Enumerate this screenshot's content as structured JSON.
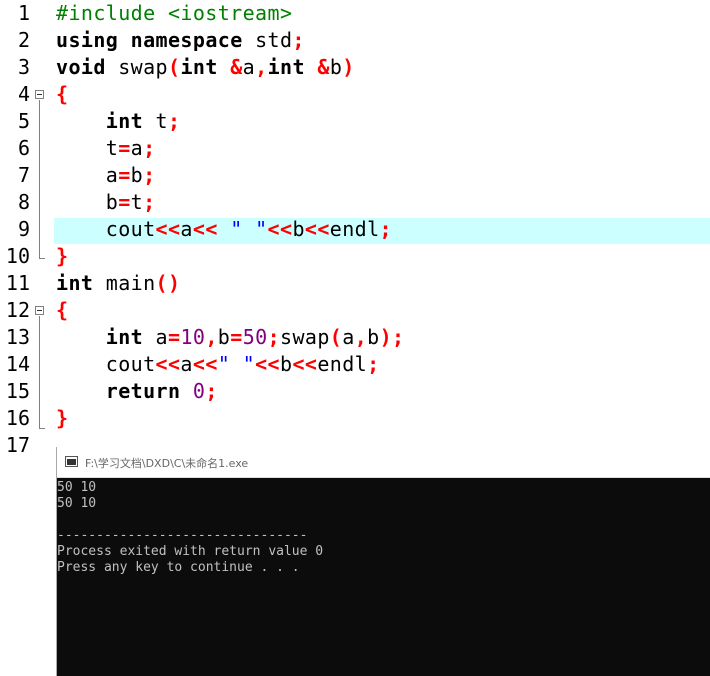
{
  "editor": {
    "active_line": 9,
    "lines": [
      {
        "n": "1",
        "tokens": [
          {
            "t": "#include <iostream>",
            "c": "pp"
          }
        ]
      },
      {
        "n": "2",
        "tokens": [
          {
            "t": "using",
            "c": "kw"
          },
          {
            "t": " ",
            "c": ""
          },
          {
            "t": "namespace",
            "c": "kw"
          },
          {
            "t": " std",
            "c": ""
          },
          {
            "t": ";",
            "c": "sym"
          }
        ]
      },
      {
        "n": "3",
        "tokens": [
          {
            "t": "void",
            "c": "kw"
          },
          {
            "t": " swap",
            "c": ""
          },
          {
            "t": "(",
            "c": "sym"
          },
          {
            "t": "int",
            "c": "kw"
          },
          {
            "t": " ",
            "c": ""
          },
          {
            "t": "&",
            "c": "sym"
          },
          {
            "t": "a",
            "c": ""
          },
          {
            "t": ",",
            "c": "sym"
          },
          {
            "t": "int",
            "c": "kw"
          },
          {
            "t": " ",
            "c": ""
          },
          {
            "t": "&",
            "c": "sym"
          },
          {
            "t": "b",
            "c": ""
          },
          {
            "t": ")",
            "c": "sym"
          }
        ]
      },
      {
        "n": "4",
        "tokens": [
          {
            "t": "{",
            "c": "sym"
          }
        ]
      },
      {
        "n": "5",
        "tokens": [
          {
            "t": "    ",
            "c": ""
          },
          {
            "t": "int",
            "c": "kw"
          },
          {
            "t": " t",
            "c": ""
          },
          {
            "t": ";",
            "c": "sym"
          }
        ]
      },
      {
        "n": "6",
        "tokens": [
          {
            "t": "    t",
            "c": ""
          },
          {
            "t": "=",
            "c": "sym"
          },
          {
            "t": "a",
            "c": ""
          },
          {
            "t": ";",
            "c": "sym"
          }
        ]
      },
      {
        "n": "7",
        "tokens": [
          {
            "t": "    a",
            "c": ""
          },
          {
            "t": "=",
            "c": "sym"
          },
          {
            "t": "b",
            "c": ""
          },
          {
            "t": ";",
            "c": "sym"
          }
        ]
      },
      {
        "n": "8",
        "tokens": [
          {
            "t": "    b",
            "c": ""
          },
          {
            "t": "=",
            "c": "sym"
          },
          {
            "t": "t",
            "c": ""
          },
          {
            "t": ";",
            "c": "sym"
          }
        ]
      },
      {
        "n": "9",
        "tokens": [
          {
            "t": "    cout",
            "c": ""
          },
          {
            "t": "<<",
            "c": "sym"
          },
          {
            "t": "a",
            "c": ""
          },
          {
            "t": "<<",
            "c": "sym"
          },
          {
            "t": " ",
            "c": ""
          },
          {
            "t": "\" \"",
            "c": "str"
          },
          {
            "t": "<<",
            "c": "sym"
          },
          {
            "t": "b",
            "c": ""
          },
          {
            "t": "<<",
            "c": "sym"
          },
          {
            "t": "endl",
            "c": ""
          },
          {
            "t": ";",
            "c": "sym"
          }
        ]
      },
      {
        "n": "10",
        "tokens": [
          {
            "t": "}",
            "c": "sym"
          }
        ]
      },
      {
        "n": "11",
        "tokens": [
          {
            "t": "int",
            "c": "kw"
          },
          {
            "t": " main",
            "c": ""
          },
          {
            "t": "()",
            "c": "sym"
          }
        ]
      },
      {
        "n": "12",
        "tokens": [
          {
            "t": "{",
            "c": "sym"
          }
        ]
      },
      {
        "n": "13",
        "tokens": [
          {
            "t": "    ",
            "c": ""
          },
          {
            "t": "int",
            "c": "kw"
          },
          {
            "t": " a",
            "c": ""
          },
          {
            "t": "=",
            "c": "sym"
          },
          {
            "t": "10",
            "c": "num-lit"
          },
          {
            "t": ",",
            "c": "sym"
          },
          {
            "t": "b",
            "c": ""
          },
          {
            "t": "=",
            "c": "sym"
          },
          {
            "t": "50",
            "c": "num-lit"
          },
          {
            "t": ";",
            "c": "sym"
          },
          {
            "t": "swap",
            "c": ""
          },
          {
            "t": "(",
            "c": "sym"
          },
          {
            "t": "a",
            "c": ""
          },
          {
            "t": ",",
            "c": "sym"
          },
          {
            "t": "b",
            "c": ""
          },
          {
            "t": ");",
            "c": "sym"
          }
        ]
      },
      {
        "n": "14",
        "tokens": [
          {
            "t": "    cout",
            "c": ""
          },
          {
            "t": "<<",
            "c": "sym"
          },
          {
            "t": "a",
            "c": ""
          },
          {
            "t": "<<",
            "c": "sym"
          },
          {
            "t": "\" \"",
            "c": "str"
          },
          {
            "t": "<<",
            "c": "sym"
          },
          {
            "t": "b",
            "c": ""
          },
          {
            "t": "<<",
            "c": "sym"
          },
          {
            "t": "endl",
            "c": ""
          },
          {
            "t": ";",
            "c": "sym"
          }
        ]
      },
      {
        "n": "15",
        "tokens": [
          {
            "t": "    ",
            "c": ""
          },
          {
            "t": "return",
            "c": "kw"
          },
          {
            "t": " ",
            "c": ""
          },
          {
            "t": "0",
            "c": "num-lit"
          },
          {
            "t": ";",
            "c": "sym"
          }
        ]
      },
      {
        "n": "16",
        "tokens": [
          {
            "t": "}",
            "c": "sym"
          }
        ]
      },
      {
        "n": "17",
        "tokens": []
      }
    ],
    "colors": {
      "highlight": "#ccffff",
      "keyword": "#000000",
      "symbol": "#ff0000",
      "preprocessor": "#008000",
      "number": "#800080",
      "string": "#0000ff"
    }
  },
  "console": {
    "title": "F:\\学习文档\\DXD\\C\\未命名1.exe",
    "icon": "console-window-icon",
    "output_lines": [
      "50 10",
      "50 10",
      "",
      "--------------------------------",
      "Process exited with return value 0",
      "Press any key to continue . . ."
    ]
  }
}
